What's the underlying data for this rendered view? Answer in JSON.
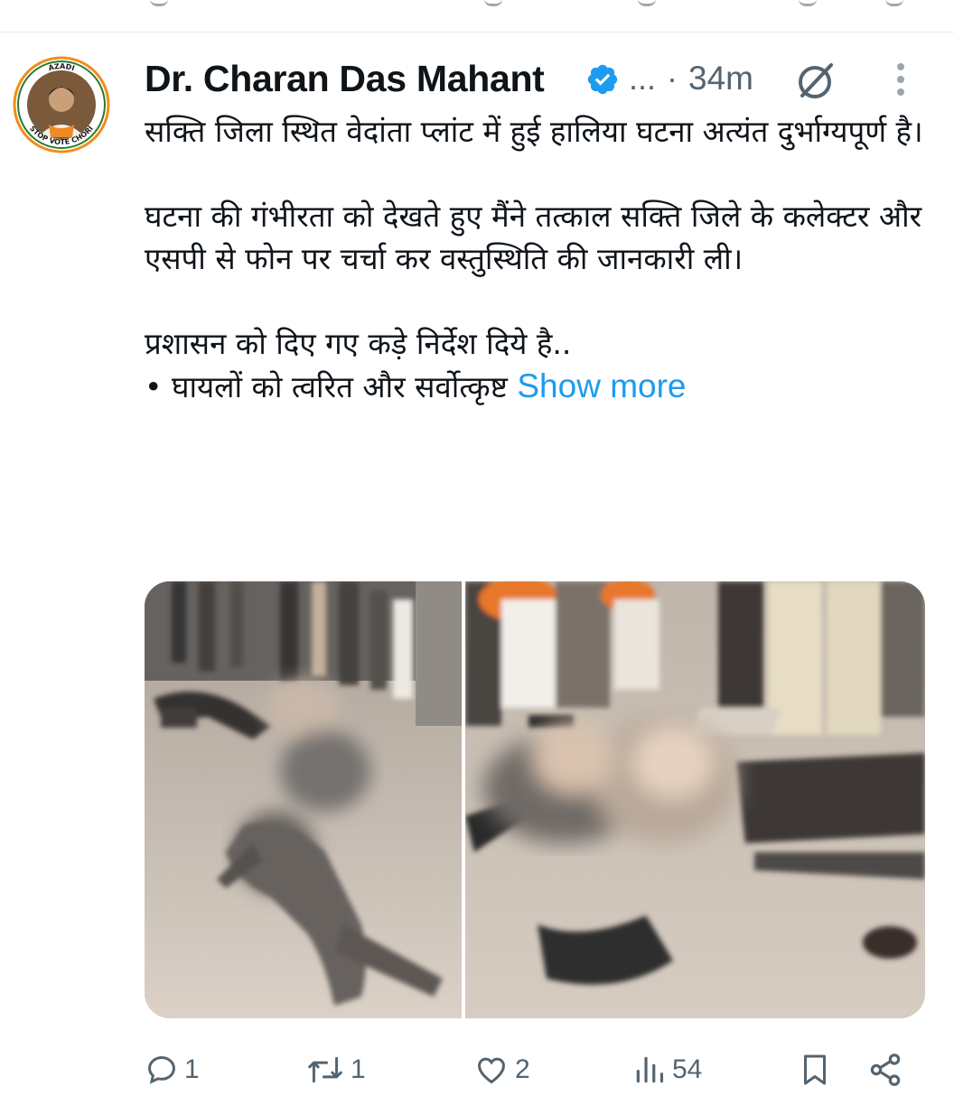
{
  "post": {
    "author_name": "Dr. Charan Das Mahant",
    "ellipsis": "...",
    "separator": "·",
    "time": "34m",
    "paragraphs": [
      "सक्ति जिला स्थित वेदांता प्लांट में हुई हालिया घटना अत्यंत दुर्भाग्यपूर्ण है।",
      "घटना की गंभीरता को देखते हुए मैंने तत्काल सक्ति जिले के कलेक्टर और एसपी से फोन पर चर्चा कर वस्तुस्थिति की जानकारी ली।",
      "प्रशासन को दिए गए कड़े निर्देश दिये है..",
      "• घायलों को त्वरित और सर्वोत्कृष्ट"
    ],
    "show_more": "Show more"
  },
  "avatar": {
    "ring_text_top": "AZADI",
    "ring_text_bottom": "STOP VOTE CHORI"
  },
  "actions": {
    "replies": "1",
    "reposts": "1",
    "likes": "2",
    "views": "54"
  },
  "icons": {
    "verified": "verified-badge-icon",
    "grok": "grok-icon",
    "more": "more-vertical-icon",
    "reply": "reply-icon",
    "repost": "repost-icon",
    "like": "heart-icon",
    "views": "views-icon",
    "bookmark": "bookmark-icon",
    "share": "share-icon"
  },
  "colors": {
    "accent": "#1d9bf0",
    "text": "#0f1419",
    "muted": "#536471"
  }
}
